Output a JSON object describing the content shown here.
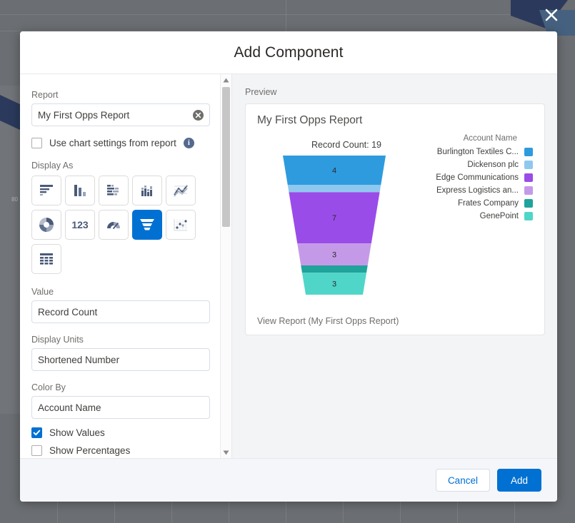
{
  "backdrop": {
    "close_icon": "close-icon",
    "axis_tick": "80"
  },
  "modal": {
    "title": "Add Component"
  },
  "settings": {
    "report": {
      "label": "Report",
      "value": "My First Opps Report",
      "clear_icon": "clear-circle-x-icon"
    },
    "use_chart_settings": {
      "label": "Use chart settings from report",
      "checked": false,
      "info_icon": "info-icon",
      "info_glyph": "i"
    },
    "display_as": {
      "label": "Display As",
      "selected": "funnel",
      "options": [
        {
          "id": "horizontal-bar",
          "name": "horizontal-bar-chart-icon",
          "selected": false
        },
        {
          "id": "vertical-bar",
          "name": "vertical-bar-chart-icon",
          "selected": false
        },
        {
          "id": "stacked-horizontal-bar",
          "name": "stacked-horizontal-bar-chart-icon",
          "selected": false
        },
        {
          "id": "stacked-vertical-bar",
          "name": "stacked-vertical-bar-chart-icon",
          "selected": false
        },
        {
          "id": "line",
          "name": "line-chart-icon",
          "selected": false
        },
        {
          "id": "donut",
          "name": "donut-chart-icon",
          "selected": false
        },
        {
          "id": "metric",
          "name": "metric-number-icon",
          "selected": false
        },
        {
          "id": "gauge",
          "name": "gauge-chart-icon",
          "selected": false
        },
        {
          "id": "funnel",
          "name": "funnel-chart-icon",
          "selected": true
        },
        {
          "id": "scatter",
          "name": "scatter-chart-icon",
          "selected": false
        },
        {
          "id": "table",
          "name": "table-icon",
          "selected": false
        }
      ]
    },
    "value": {
      "label": "Value",
      "value": "Record Count"
    },
    "display_units": {
      "label": "Display Units",
      "value": "Shortened Number"
    },
    "color_by": {
      "label": "Color By",
      "value": "Account Name"
    },
    "show_values": {
      "label": "Show Values",
      "checked": true
    },
    "show_percentages": {
      "label": "Show Percentages",
      "checked": false
    },
    "scrollbar": {
      "up_icon": "scroll-up-arrow-icon",
      "down_icon": "scroll-down-arrow-icon"
    }
  },
  "preview": {
    "label": "Preview",
    "card_title": "My First Opps Report",
    "view_report_link": "View Report (My First Opps Report)"
  },
  "chart_data": {
    "type": "funnel",
    "title": "My First Opps Report",
    "total_label": "Record Count: 19",
    "total": 19,
    "value_field": "Record Count",
    "color_by": "Account Name",
    "legend_title": "Account Name",
    "legend_position": "right",
    "show_values": true,
    "show_percentages": false,
    "categories": [
      "Burlington Textiles C...",
      "Dickenson plc",
      "Edge Communications",
      "Express Logistics an...",
      "Frates Company",
      "GenePoint"
    ],
    "values": [
      4,
      1,
      7,
      3,
      1,
      3
    ],
    "labels": [
      "4",
      "",
      "7",
      "3",
      "",
      "3"
    ],
    "colors": [
      "#2e9bdf",
      "#8fc8ee",
      "#9a4ce8",
      "#c49ae8",
      "#1fa39b",
      "#4fd6c9"
    ]
  },
  "footer": {
    "cancel_label": "Cancel",
    "add_label": "Add"
  }
}
